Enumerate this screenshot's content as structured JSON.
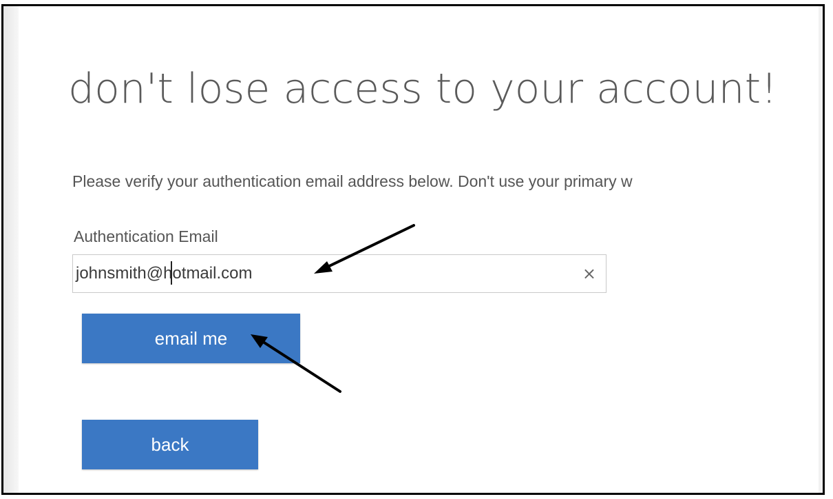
{
  "page": {
    "title": "don't lose access to your account!",
    "instruction": "Please verify your authentication email address below. Don't use your primary w",
    "email_label": "Authentication Email",
    "email_value": "johnsmith@hotmail.com",
    "clear_icon": "×",
    "email_me_label": "email me",
    "back_label": "back"
  },
  "colors": {
    "button_blue": "#3b78c4",
    "title_gray": "#5a5a5a",
    "text_gray": "#555555",
    "frame_border": "#000000"
  },
  "icons": {
    "clear": "close-icon",
    "annotation": "arrow-icon"
  }
}
